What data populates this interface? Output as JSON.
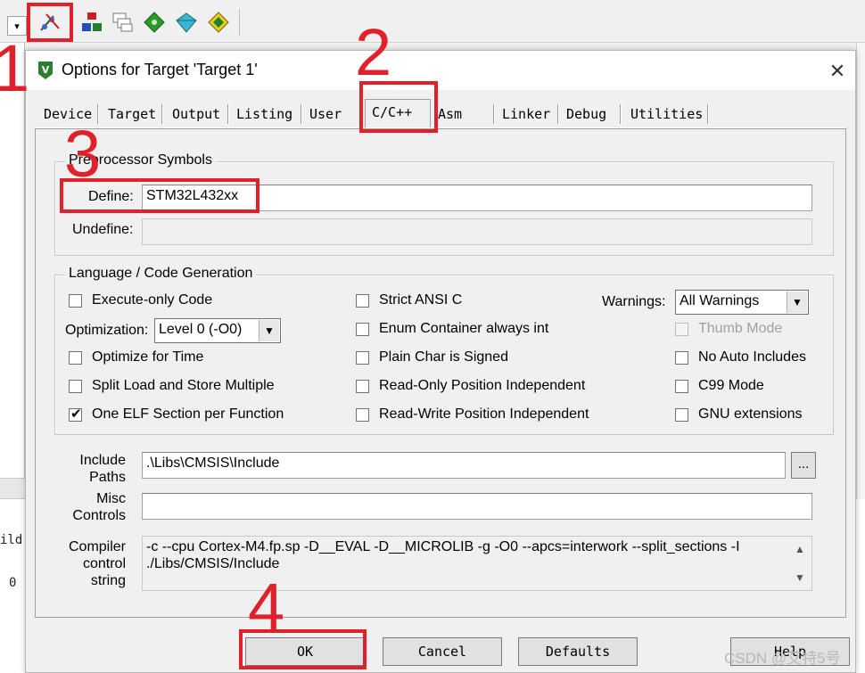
{
  "background": {
    "left_text_1": "ild",
    "left_text_2": "0"
  },
  "dialog": {
    "title": "Options for Target 'Target 1'",
    "close_symbol": "✕"
  },
  "tabs": [
    {
      "label": "Device"
    },
    {
      "label": "Target"
    },
    {
      "label": "Output"
    },
    {
      "label": "Listing"
    },
    {
      "label": "User"
    },
    {
      "label": "C/C++"
    },
    {
      "label": "Asm"
    },
    {
      "label": "Linker"
    },
    {
      "label": "Debug"
    },
    {
      "label": "Utilities"
    }
  ],
  "active_tab": "C/C++",
  "preprocessor": {
    "legend": "Preprocessor Symbols",
    "define_label": "Define:",
    "define_value": "STM32L432xx",
    "undefine_label": "Undefine:",
    "undefine_value": ""
  },
  "language": {
    "legend": "Language / Code Generation",
    "execute_only_code": "Execute-only Code",
    "optimization_label": "Optimization:",
    "optimization_value": "Level 0 (-O0)",
    "optimize_for_time": "Optimize for Time",
    "split_load_store": "Split Load and Store Multiple",
    "one_elf_section": "One ELF Section per Function",
    "strict_ansi_c": "Strict ANSI C",
    "enum_container": "Enum Container always int",
    "plain_char_signed": "Plain Char is Signed",
    "readonly_pos_indep": "Read-Only Position Independent",
    "readwrite_pos_indep": "Read-Write Position Independent",
    "warnings_label": "Warnings:",
    "warnings_value": "All Warnings",
    "thumb_mode": "Thumb Mode",
    "no_auto_includes": "No Auto Includes",
    "c99_mode": "C99 Mode",
    "gnu_extensions": "GNU extensions",
    "one_elf_checked": "✔"
  },
  "paths": {
    "include_label_1": "Include",
    "include_label_2": "Paths",
    "include_value": ".\\Libs\\CMSIS\\Include",
    "browse_label": "...",
    "misc_label_1": "Misc",
    "misc_label_2": "Controls",
    "misc_value": "",
    "compiler_label_1": "Compiler",
    "compiler_label_2": "control",
    "compiler_label_3": "string",
    "compiler_line_1": "-c --cpu Cortex-M4.fp.sp -D__EVAL -D__MICROLIB -g -O0 --apcs=interwork --split_sections -I",
    "compiler_line_2": "./Libs/CMSIS/Include",
    "scroll_up": "▲",
    "scroll_down": "▼"
  },
  "buttons": {
    "ok": "OK",
    "cancel": "Cancel",
    "defaults": "Defaults",
    "help": "Help"
  },
  "annotations": {
    "n1": "1",
    "n2": "2",
    "n3": "3",
    "n4": "4",
    "color": "#e0202a"
  },
  "watermark": "CSDN @艾特5号",
  "icons": [
    "options-for-target-icon",
    "manage-components-icon",
    "copy-icon",
    "green-diamond-icon",
    "cyan-diamond-icon",
    "run-environment-icon",
    "keil-logo-icon",
    "close-icon",
    "combo-arrow-icon",
    "scroll-up-icon",
    "scroll-down-icon"
  ]
}
